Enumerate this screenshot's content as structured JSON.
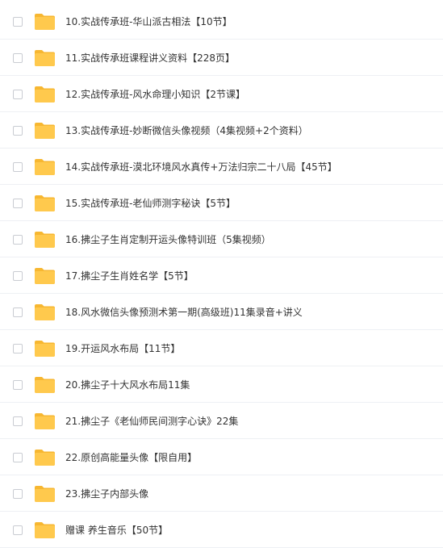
{
  "folder_color": "#ffc94d",
  "folder_tab_color": "#f7b731",
  "items": [
    {
      "name": "10.实战传承班-华山派古相法【10节】"
    },
    {
      "name": "11.实战传承班课程讲义资料【228页】"
    },
    {
      "name": "12.实战传承班-风水命理小知识【2节课】"
    },
    {
      "name": "13.实战传承班-妙断微信头像视频（4集视频+2个资料）"
    },
    {
      "name": "14.实战传承班-漠北环境风水真传+万法归宗二十八局【45节】"
    },
    {
      "name": "15.实战传承班-老仙师测字秘诀【5节】"
    },
    {
      "name": "16.拂尘子生肖定制开运头像特训班（5集视频）"
    },
    {
      "name": "17.拂尘子生肖姓名学【5节】"
    },
    {
      "name": "18.风水微信头像预测术第一期(高级班)11集录音+讲义"
    },
    {
      "name": "19.开运风水布局【11节】"
    },
    {
      "name": "20.拂尘子十大风水布局11集"
    },
    {
      "name": "21.拂尘子《老仙师民间测字心诀》22集"
    },
    {
      "name": "22.原创高能量头像【限自用】"
    },
    {
      "name": "23.拂尘子内部头像"
    },
    {
      "name": "赠课 养生音乐【50节】"
    }
  ]
}
